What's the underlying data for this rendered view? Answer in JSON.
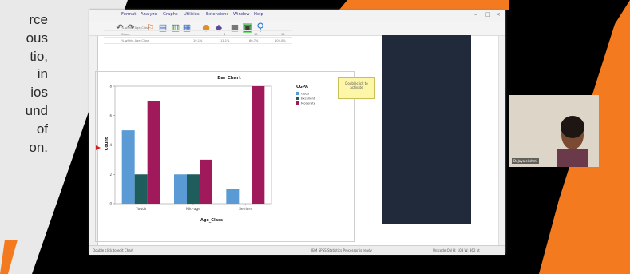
{
  "slide": {
    "text_lines": [
      "rce",
      "ous",
      "tio,",
      "in",
      "ios",
      "und",
      "of",
      "on."
    ]
  },
  "spss": {
    "menu": [
      "Format",
      "Analyze",
      "Graphs",
      "Utilities",
      "Extensions",
      "Window",
      "Help"
    ],
    "table": {
      "rows": [
        {
          "label": "% within Age_Class",
          "values": [
            "",
            "",
            "",
            ""
          ]
        },
        {
          "label": "Count",
          "values": [
            "",
            "8",
            "10",
            "10"
          ]
        },
        {
          "label": "% within Age_Class",
          "values": [
            "19.1%",
            "11.1%",
            "66.7%",
            "100.0%"
          ]
        }
      ]
    },
    "note": "Doubleclick to activate",
    "status_left": "Double click to edit Chart",
    "status_mid": "IBM SPSS Statistics Processor is ready",
    "status_right": "Unicode:ON  H: 103  W: 362 pt",
    "webcam_name": "Dr.Jayalekshmi"
  },
  "chart_data": {
    "type": "bar",
    "title": "Bar Chart",
    "xlabel": "Age_Class",
    "ylabel": "Count",
    "ylim": [
      0,
      8
    ],
    "yticks": [
      0,
      2,
      4,
      6,
      8
    ],
    "categories": [
      "Youth",
      "Mid-age",
      "Seniors"
    ],
    "legend_title": "CGPA",
    "legend_position": "right",
    "series": [
      {
        "name": "Good",
        "color": "#5b9bd5",
        "values": [
          5,
          2,
          1
        ]
      },
      {
        "name": "Excellent",
        "color": "#1f5c5c",
        "values": [
          2,
          2,
          0
        ]
      },
      {
        "name": "Moderate",
        "color": "#a0195a",
        "values": [
          7,
          3,
          8
        ]
      }
    ]
  },
  "colors": {
    "orange": "#f47a1f",
    "slide_gray": "#e6e6e6"
  }
}
